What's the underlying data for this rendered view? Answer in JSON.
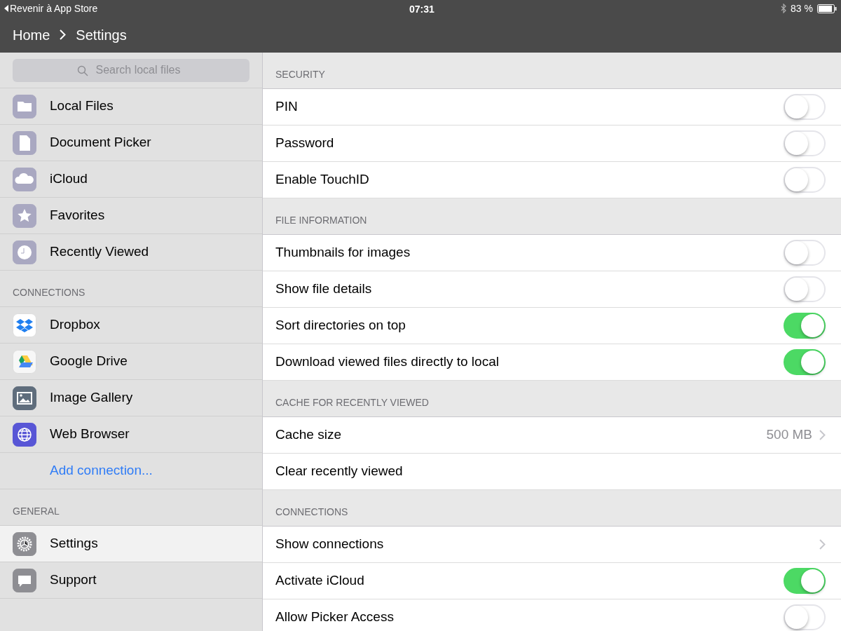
{
  "status_bar": {
    "back": "Revenir à App Store",
    "time": "07:31",
    "battery": "83 %"
  },
  "nav": {
    "crumbs": [
      "Home",
      "Settings"
    ]
  },
  "sidebar": {
    "search": {
      "placeholder": "Search local files"
    },
    "sections": [
      {
        "items": [
          {
            "label": "Local Files",
            "selected": false
          },
          {
            "label": "Document Picker",
            "selected": false
          },
          {
            "label": "iCloud",
            "selected": false
          },
          {
            "label": "Favorites",
            "selected": false
          },
          {
            "label": "Recently Viewed",
            "selected": false
          }
        ]
      },
      {
        "title": "CONNECTIONS",
        "items": [
          {
            "label": "Dropbox",
            "selected": false
          },
          {
            "label": "Google Drive",
            "selected": false
          },
          {
            "label": "Image Gallery",
            "selected": false
          },
          {
            "label": "Web Browser",
            "selected": false
          }
        ],
        "add_link": "Add connection..."
      },
      {
        "title": "GENERAL",
        "items": [
          {
            "label": "Settings",
            "selected": true
          },
          {
            "label": "Support",
            "selected": false
          }
        ]
      }
    ]
  },
  "settings": [
    {
      "title": "SECURITY",
      "rows": [
        {
          "kind": "toggle",
          "label": "PIN",
          "on": false
        },
        {
          "kind": "toggle",
          "label": "Password",
          "on": false
        },
        {
          "kind": "toggle",
          "label": "Enable TouchID",
          "on": false
        }
      ]
    },
    {
      "title": "FILE INFORMATION",
      "rows": [
        {
          "kind": "toggle",
          "label": "Thumbnails for images",
          "on": false
        },
        {
          "kind": "toggle",
          "label": "Show file details",
          "on": false
        },
        {
          "kind": "toggle",
          "label": "Sort directories on top",
          "on": true
        },
        {
          "kind": "toggle",
          "label": "Download viewed files directly to local",
          "on": true
        }
      ]
    },
    {
      "title": "CACHE FOR RECENTLY VIEWED",
      "rows": [
        {
          "kind": "link",
          "label": "Cache size",
          "value": "500 MB"
        },
        {
          "kind": "action",
          "label": "Clear recently viewed"
        }
      ]
    },
    {
      "title": "CONNECTIONS",
      "rows": [
        {
          "kind": "link",
          "label": "Show connections"
        },
        {
          "kind": "toggle",
          "label": "Activate iCloud",
          "on": true
        },
        {
          "kind": "toggle",
          "label": "Allow Picker Access",
          "on": false
        }
      ]
    }
  ]
}
